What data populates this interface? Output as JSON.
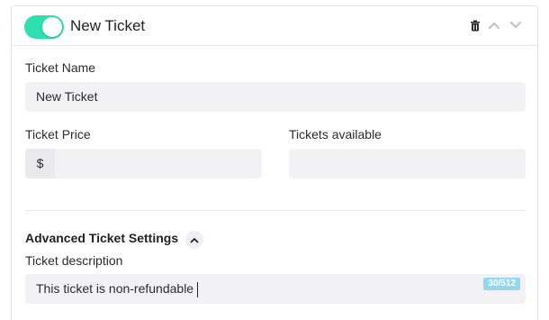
{
  "header": {
    "title": "New Ticket",
    "toggle_on": true,
    "toggle_color": "#2ee0ad"
  },
  "form": {
    "ticket_name": {
      "label": "Ticket Name",
      "value": "New Ticket"
    },
    "ticket_price": {
      "label": "Ticket Price",
      "prefix": "$",
      "value": ""
    },
    "tickets_available": {
      "label": "Tickets available",
      "value": ""
    }
  },
  "advanced": {
    "title": "Advanced Ticket Settings",
    "description": {
      "label": "Ticket description",
      "value": "This ticket is non-refundable",
      "counter": "30/512"
    }
  },
  "icons": {
    "delete": "trash-icon",
    "move_up": "chevron-up-icon",
    "move_down": "chevron-down-icon",
    "collapse": "chevron-up-icon"
  }
}
